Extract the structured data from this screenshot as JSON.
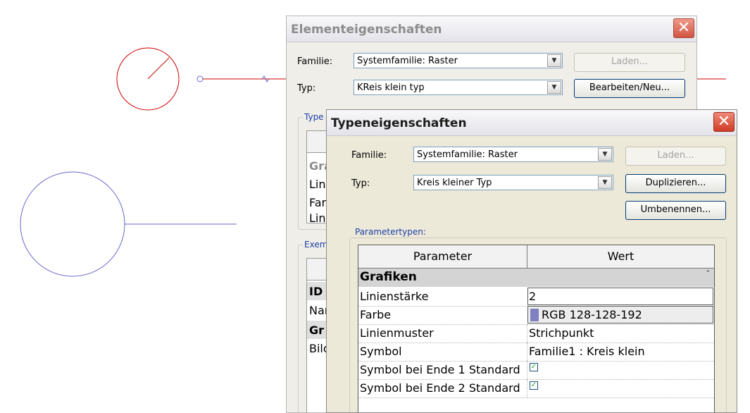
{
  "colors": {
    "sketch_red": "#cc0000",
    "sketch_blue": "#6666cc",
    "swatch": "#8080c0"
  },
  "back_dialog": {
    "title": "Elementeigenschaften",
    "familie_label": "Familie:",
    "familie_value": "Systemfamilie: Raster",
    "typ_label": "Typ:",
    "typ_value": "KReis klein typ",
    "laden_label": "Laden...",
    "bearbeiten_label": "Bearbeiten/Neu...",
    "type_group_title": "Type",
    "type_rows": [
      "Gra",
      "Lini",
      "Far",
      "Lin"
    ],
    "exemplar_group_title": "Exem",
    "exemplar_rows": [
      "ID",
      "Nar",
      "Gr",
      "Bild"
    ]
  },
  "front_dialog": {
    "title": "Typeneigenschaften",
    "familie_label": "Familie:",
    "familie_value": "Systemfamilie: Raster",
    "typ_label": "Typ:",
    "typ_value": "Kreis kleiner Typ",
    "laden_label": "Laden...",
    "duplizieren_label": "Duplizieren...",
    "umbenennen_label": "Umbenennen...",
    "group_title": "Parametertypen:",
    "grid": {
      "headers": [
        "Parameter",
        "Wert"
      ],
      "group": "Grafiken",
      "collapse_glyph": "ˆ",
      "rows": [
        {
          "param": "Linienstärke",
          "value": "2",
          "kind": "edit"
        },
        {
          "param": "Farbe",
          "value": "RGB 128-128-192",
          "kind": "color"
        },
        {
          "param": "Linienmuster",
          "value": "Strichpunkt",
          "kind": "text"
        },
        {
          "param": "Symbol",
          "value": "Familie1 : Kreis klein",
          "kind": "text"
        },
        {
          "param": "Symbol bei Ende 1 Standard",
          "value": "✓",
          "kind": "check"
        },
        {
          "param": "Symbol bei Ende 2 Standard",
          "value": "✓",
          "kind": "check"
        }
      ]
    }
  },
  "icons": {
    "close": "close-icon",
    "dropdown": "chevron-down-icon"
  }
}
